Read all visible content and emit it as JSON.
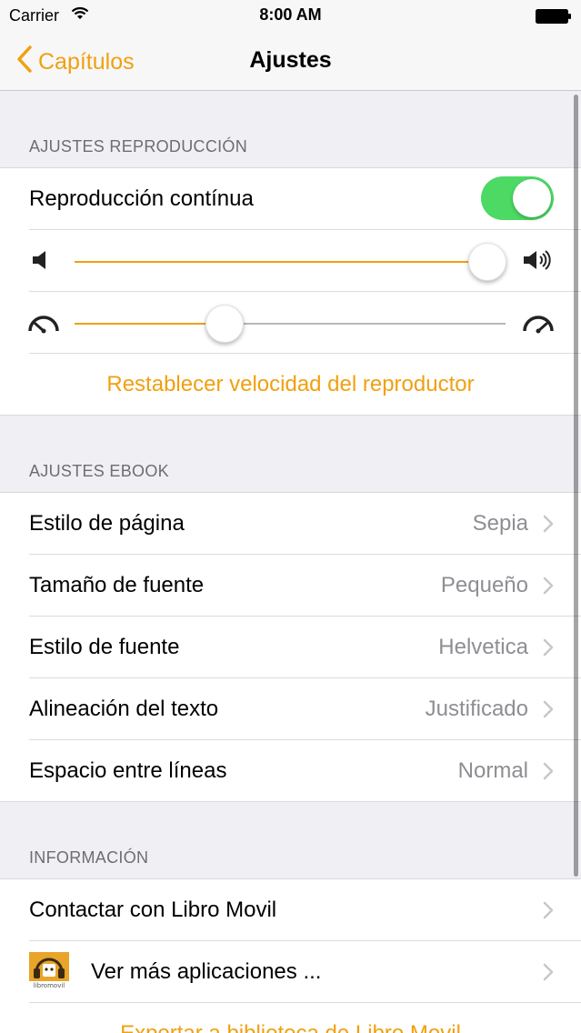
{
  "status_bar": {
    "carrier": "Carrier",
    "time": "8:00 AM"
  },
  "nav": {
    "back_label": "Capítulos",
    "title": "Ajustes"
  },
  "accent_color": "#f0a010",
  "sections": {
    "playback": {
      "header": "AJUSTES REPRODUCCIÓN",
      "continuous_label": "Reproducción contínua",
      "continuous_on": true,
      "volume_level": 0.95,
      "speed_level": 0.35,
      "reset_label": "Restablecer velocidad del reproductor"
    },
    "ebook": {
      "header": "AJUSTES EBOOK",
      "rows": [
        {
          "label": "Estilo de página",
          "value": "Sepia"
        },
        {
          "label": "Tamaño de fuente",
          "value": "Pequeño"
        },
        {
          "label": "Estilo de fuente",
          "value": "Helvetica"
        },
        {
          "label": "Alineación del texto",
          "value": "Justificado"
        },
        {
          "label": "Espacio entre líneas",
          "value": "Normal"
        }
      ]
    },
    "info": {
      "header": "INFORMACIÓN",
      "contact_label": "Contactar con Libro Movil",
      "more_apps_label": "Ver más aplicaciones ...",
      "app_icon_text": "libromovil",
      "export_label": "Exportar a biblioteca de Libro Movil"
    }
  },
  "icons": {
    "back": "chevron-left-icon",
    "wifi": "wifi-icon",
    "battery": "battery-icon",
    "volume_low": "speaker-low-icon",
    "volume_high": "speaker-high-icon",
    "speed_slow": "speedometer-slow-icon",
    "speed_fast": "speedometer-fast-icon",
    "chevron": "chevron-right-icon"
  }
}
